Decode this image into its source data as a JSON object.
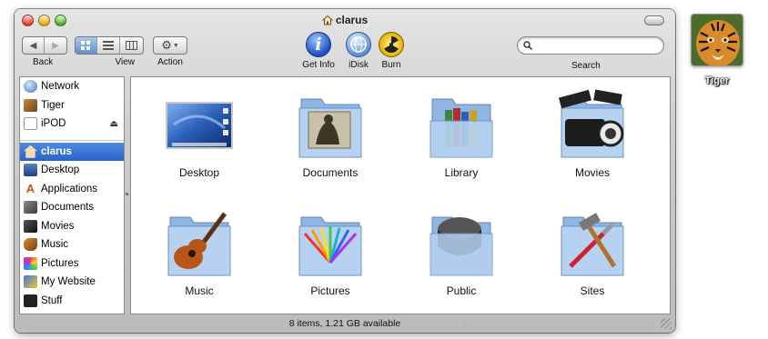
{
  "window": {
    "title": "clarus",
    "status": "8 items, 1.21 GB available"
  },
  "toolbar": {
    "back_label": "Back",
    "view_label": "View",
    "action_label": "Action",
    "getinfo_label": "Get Info",
    "idisk_label": "iDisk",
    "burn_label": "Burn",
    "search_label": "Search",
    "search_value": ""
  },
  "sidebar": {
    "devices": [
      {
        "label": "Network",
        "icon": "globe-icon"
      },
      {
        "label": "Tiger",
        "icon": "hard-drive-icon"
      },
      {
        "label": "iPOD",
        "icon": "ipod-icon"
      }
    ],
    "places": [
      {
        "label": "clarus",
        "icon": "home-icon",
        "selected": true
      },
      {
        "label": "Desktop",
        "icon": "desktop-icon"
      },
      {
        "label": "Applications",
        "icon": "applications-icon"
      },
      {
        "label": "Documents",
        "icon": "documents-icon"
      },
      {
        "label": "Movies",
        "icon": "movies-icon"
      },
      {
        "label": "Music",
        "icon": "music-icon"
      },
      {
        "label": "Pictures",
        "icon": "pictures-icon"
      },
      {
        "label": "My Website",
        "icon": "website-icon"
      },
      {
        "label": "Stuff",
        "icon": "stuff-icon"
      }
    ]
  },
  "items": [
    {
      "label": "Desktop",
      "icon": "desktop-folder-icon"
    },
    {
      "label": "Documents",
      "icon": "documents-folder-icon"
    },
    {
      "label": "Library",
      "icon": "library-folder-icon"
    },
    {
      "label": "Movies",
      "icon": "movies-folder-icon"
    },
    {
      "label": "Music",
      "icon": "music-folder-icon"
    },
    {
      "label": "Pictures",
      "icon": "pictures-folder-icon"
    },
    {
      "label": "Public",
      "icon": "public-folder-icon"
    },
    {
      "label": "Sites",
      "icon": "sites-folder-icon"
    }
  ],
  "desktop": {
    "drive_label": "Tiger"
  },
  "colors": {
    "selection": "#2a63c7",
    "folder": "#9fc4ec"
  }
}
